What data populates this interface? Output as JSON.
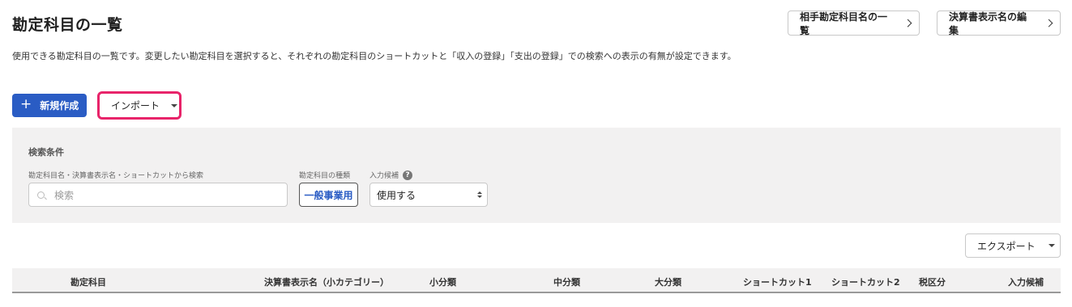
{
  "header": {
    "title": "勘定科目の一覧",
    "partner_button": "相手勘定科目名の一覧",
    "statement_button": "決算書表示名の編集"
  },
  "description": "使用できる勘定科目の一覧です。変更したい勘定科目を選択すると、それぞれの勘定科目のショートカットと「収入の登録」「支出の登録」での検索への表示の有無が設定できます。",
  "actions": {
    "new_label": "新規作成",
    "import_label": "インポート",
    "export_label": "エクスポート"
  },
  "search": {
    "title": "検索条件",
    "keyword_label": "勘定科目名・決算書表示名・ショートカットから検索",
    "placeholder": "検索",
    "type_label": "勘定科目の種類",
    "type_value": "一般事業用",
    "candidate_label": "入力候補",
    "candidate_value": "使用する"
  },
  "table": {
    "columns": [
      "勘定科目",
      "決算書表示名（小カテゴリー）",
      "小分類",
      "中分類",
      "大分類",
      "ショートカット1",
      "ショートカット2",
      "税区分",
      "入力候補"
    ]
  },
  "colors": {
    "primary": "#2a5cc4",
    "highlight": "#e8246a",
    "panel": "#f2f1f1"
  },
  "icons": {
    "plus": "plus-icon",
    "search": "search-icon",
    "help": "help-icon",
    "chevron": "chevron-right-icon",
    "caret": "caret-down-icon"
  }
}
